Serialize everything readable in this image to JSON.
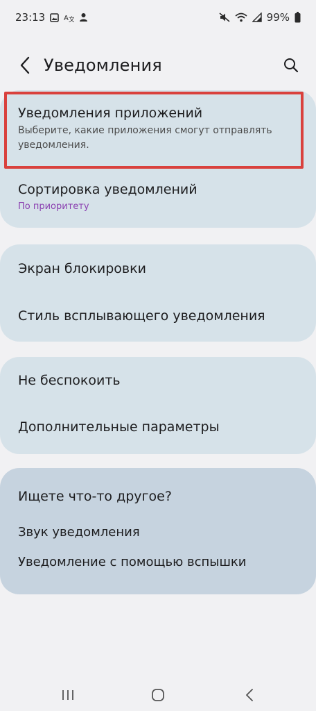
{
  "status_bar": {
    "time": "23:13",
    "battery": "99%",
    "left_icons": [
      "gallery-icon",
      "translate-icon",
      "person-icon"
    ],
    "right_icons": [
      "mute-icon",
      "wifi-icon",
      "signal-icon",
      "battery-icon"
    ]
  },
  "header": {
    "title": "Уведомления"
  },
  "group1": {
    "app_notifications": {
      "title": "Уведомления приложений",
      "subtitle": "Выберите, какие приложения смогут отправлять уведомления."
    },
    "sorting": {
      "title": "Сортировка уведомлений",
      "value": "По приоритету"
    }
  },
  "group2": {
    "lock_screen": "Экран блокировки",
    "popup_style": "Стиль всплывающего уведомления"
  },
  "group3": {
    "do_not_disturb": "Не беспокоить",
    "advanced": "Дополнительные параметры"
  },
  "group4": {
    "heading": "Ищете что-то другое?",
    "links": [
      "Звук уведомления",
      "Уведомление с помощью вспышки"
    ]
  },
  "colors": {
    "background": "#f1f1f3",
    "card": "#d6e2e9",
    "card_suggest": "#c6d3df",
    "highlight": "#d9413d",
    "accent": "#8a3fb0"
  },
  "nav_bar": {
    "buttons": [
      "recents-icon",
      "home-icon",
      "back-icon"
    ]
  }
}
